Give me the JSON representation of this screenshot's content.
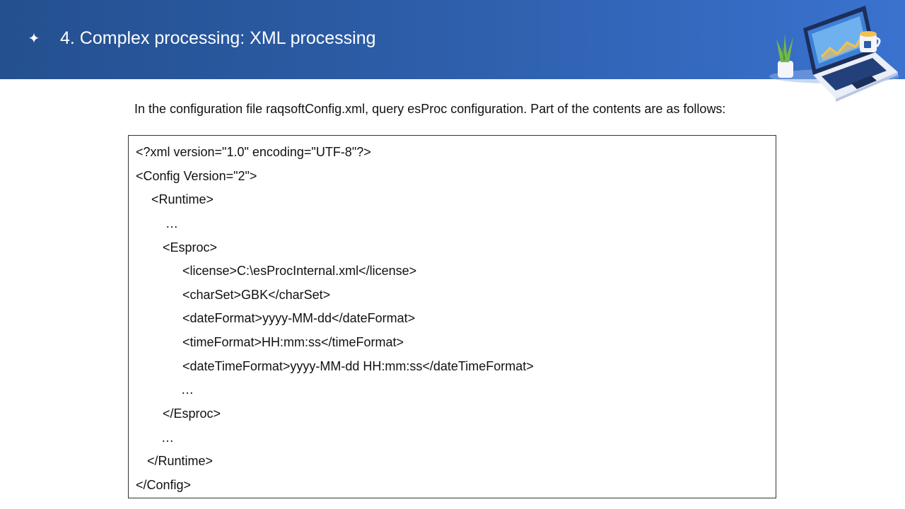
{
  "header": {
    "bullet_icon": "sparkle-icon",
    "title": "4. Complex processing: XML processing",
    "illustration_icon": "laptop-desk-illustration"
  },
  "intro": "In the configuration file raqsoftConfig.xml, query esProc configuration. Part of the contents are as follows:",
  "code": {
    "lines": [
      "<?xml version=\"1.0\" encoding=\"UTF-8\"?>",
      "<Config Version=\"2\">",
      "<Runtime>",
      "…",
      "<Esproc>",
      "<license>C:\\esProcInternal.xml</license>",
      "<charSet>GBK</charSet>",
      "<dateFormat>yyyy-MM-dd</dateFormat>",
      "<timeFormat>HH:mm:ss</timeFormat>",
      "<dateTimeFormat>yyyy-MM-dd HH:mm:ss</dateTimeFormat>",
      "…",
      "</Esproc>",
      "…",
      "</Runtime>",
      "</Config>"
    ]
  }
}
